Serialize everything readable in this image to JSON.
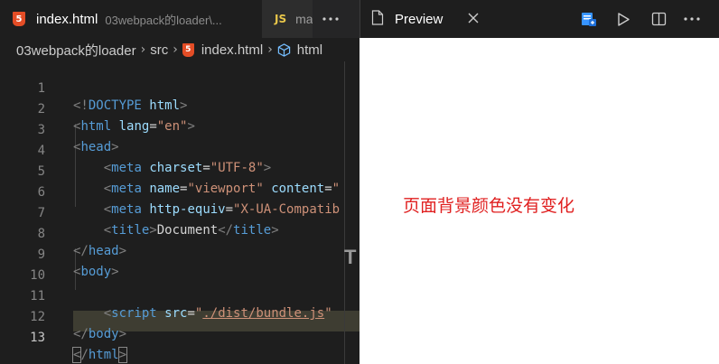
{
  "editor": {
    "tabs": [
      {
        "icon": "html5-icon",
        "title": "index.html",
        "description": "03webpack的loader\\..."
      },
      {
        "icon": "js-icon",
        "icon_text": "JS",
        "title": "ma"
      }
    ],
    "breadcrumb": [
      "03webpack的loader",
      "src",
      "index.html",
      "html"
    ],
    "code_lines": [
      {
        "num": "1"
      },
      {
        "num": "2"
      },
      {
        "num": "3"
      },
      {
        "num": "4"
      },
      {
        "num": "5"
      },
      {
        "num": "6"
      },
      {
        "num": "7"
      },
      {
        "num": "8"
      },
      {
        "num": "9"
      },
      {
        "num": "10"
      },
      {
        "num": "11"
      },
      {
        "num": "12"
      },
      {
        "num": "13"
      }
    ],
    "code": {
      "l1": {
        "p1": "<!",
        "kw": "DOCTYPE",
        "p2": " html",
        "p3": ">"
      },
      "l2": {
        "tag": "html",
        "attr": "lang",
        "val": "\"en\""
      },
      "l3": {
        "tag": "head"
      },
      "l4": {
        "tag": "meta",
        "attr": "charset",
        "val": "\"UTF-8\""
      },
      "l5": {
        "tag": "meta",
        "attr": "name",
        "val": "\"viewport\"",
        "attr2": "content",
        "val2": "\""
      },
      "l6": {
        "tag": "meta",
        "attr": "http-equiv",
        "val": "\"X-UA-Compatib"
      },
      "l7": {
        "tag": "title",
        "text": "Document"
      },
      "l8": {
        "tag": "head"
      },
      "l9": {
        "tag": "body"
      },
      "l11": {
        "tag": "script",
        "attr": "src",
        "val": "./dist/bundle.js",
        "q": "\""
      },
      "l12": {
        "tag": "body"
      },
      "l13": {
        "tag": "html"
      }
    },
    "hover_glyph": "T"
  },
  "preview": {
    "tab_title": "Preview",
    "message": "页面背景颜色没有变化"
  },
  "colors": {
    "accent_blue": "#3794ff",
    "message_red": "#e02020"
  }
}
